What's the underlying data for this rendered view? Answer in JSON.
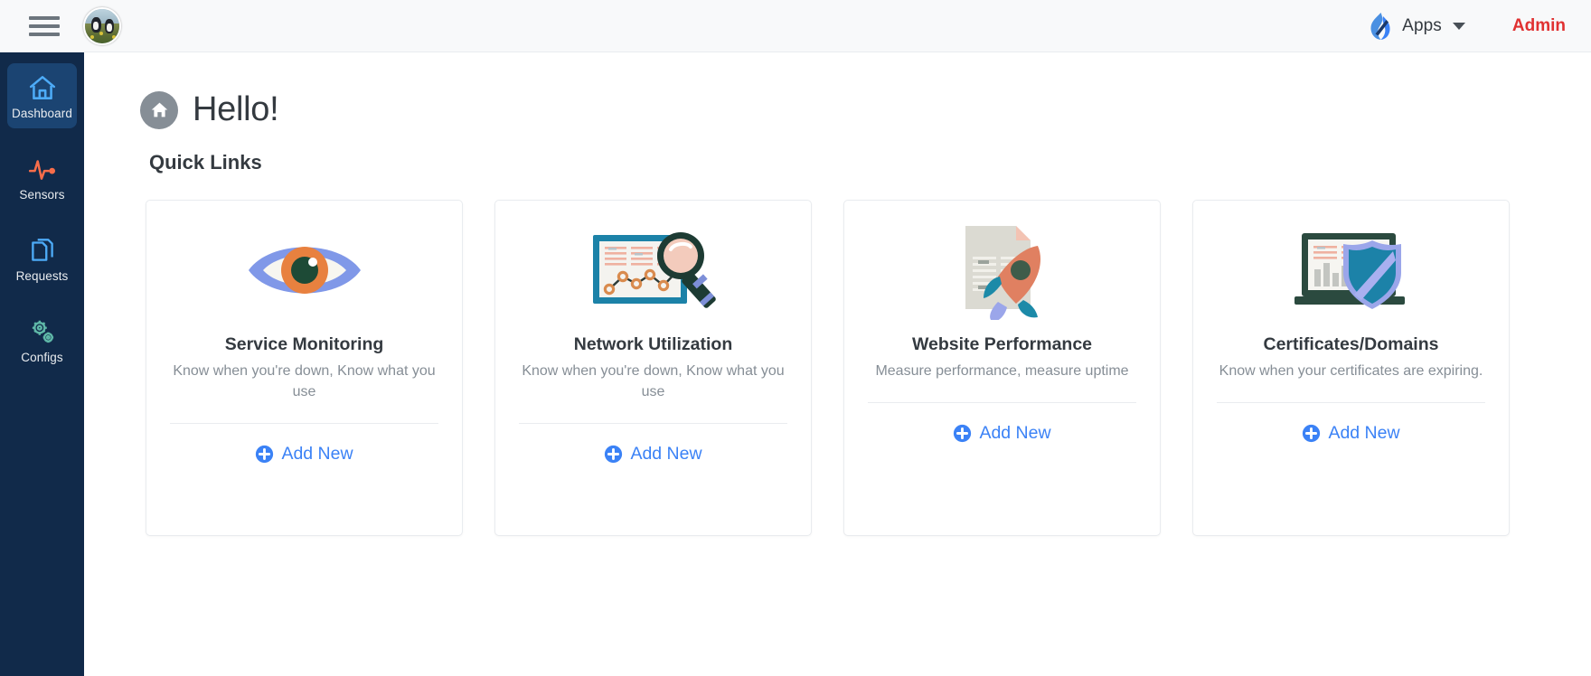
{
  "topbar": {
    "menu_icon": "hamburger-menu-icon",
    "avatar": "user-avatar",
    "apps_logo_icon": "apps-flame-logo-icon",
    "apps_label": "Apps",
    "apps_caret_icon": "chevron-down-icon",
    "admin_label": "Admin",
    "admin_color": "#e03131",
    "background": "#f8f9fa"
  },
  "sidebar": {
    "background": "#112a4a",
    "active_background": "#1b4472",
    "items": [
      {
        "label": "Dashboard",
        "icon": "home-icon",
        "active": true,
        "icon_color": "#4dabf7"
      },
      {
        "label": "Sensors",
        "icon": "pulse-icon",
        "active": false,
        "icon_color": "#f76d4a"
      },
      {
        "label": "Requests",
        "icon": "documents-icon",
        "active": false,
        "icon_color": "#4dabf7"
      },
      {
        "label": "Configs",
        "icon": "gears-icon",
        "active": false,
        "icon_color": "#5fb8a8"
      }
    ]
  },
  "main": {
    "greeting_icon": "home-badge-icon",
    "greeting": "Hello!",
    "quick_links_title": "Quick Links",
    "accent_color": "#3b82f6",
    "cards": [
      {
        "icon": "eye-monitoring-icon",
        "title": "Service Monitoring",
        "description": "Know when you're down, Know what you use",
        "action_icon": "plus-circle-icon",
        "action_label": "Add New"
      },
      {
        "icon": "chart-magnifier-icon",
        "title": "Network Utilization",
        "description": "Know when you're down, Know what you use",
        "action_icon": "plus-circle-icon",
        "action_label": "Add New"
      },
      {
        "icon": "document-rocket-icon",
        "title": "Website Performance",
        "description": "Measure performance, measure uptime",
        "action_icon": "plus-circle-icon",
        "action_label": "Add New"
      },
      {
        "icon": "laptop-shield-icon",
        "title": "Certificates/Domains",
        "description": "Know when your certificates are expiring.",
        "action_icon": "plus-circle-icon",
        "action_label": "Add New"
      }
    ]
  }
}
